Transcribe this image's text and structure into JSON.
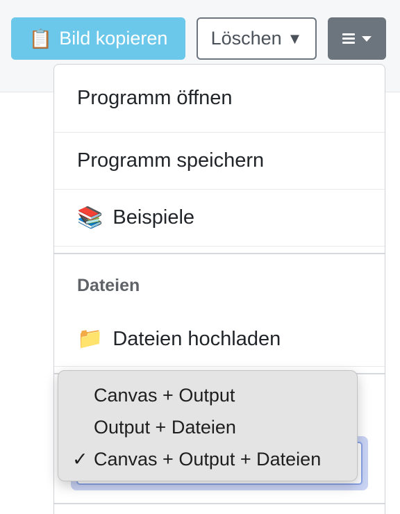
{
  "toolbar": {
    "copy_icon": "clipboard-icon",
    "copy_emoji": "📋",
    "copy_label": "Bild kopieren",
    "delete_label": "Löschen",
    "delete_caret": "▼",
    "menu_icon": "hamburger-icon",
    "colors": {
      "copy_bg": "#6cc8ea",
      "menu_bg": "#6c757d"
    }
  },
  "menu": {
    "items": [
      {
        "label": "Programm öffnen"
      },
      {
        "label": "Programm speichern"
      },
      {
        "label": "Beispiele",
        "icon": "books-icon",
        "emoji": "📚"
      }
    ],
    "files_header": "Dateien",
    "upload": {
      "label": "Dateien hochladen",
      "icon": "folder-icon",
      "emoji": "📁"
    }
  },
  "layout_select": {
    "options": [
      {
        "label": "Canvas + Output",
        "selected": false
      },
      {
        "label": "Output + Dateien",
        "selected": false
      },
      {
        "label": "Canvas + Output + Dateien",
        "selected": true
      }
    ],
    "check_mark": "✓"
  }
}
